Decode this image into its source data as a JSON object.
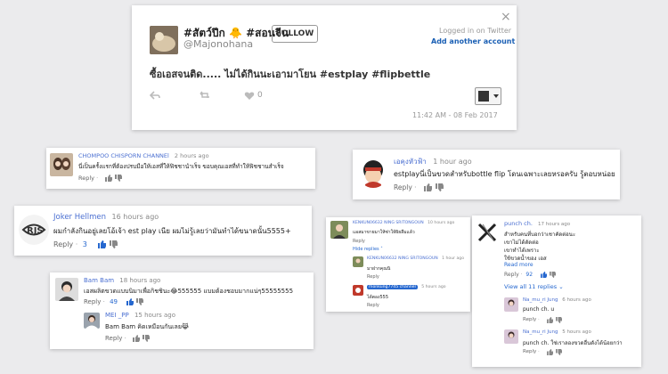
{
  "tweet": {
    "display_name": "#สัตว์ปีก 🐥 #สอนจีน",
    "handle": "@Majonohana",
    "follow_label": "FOLLOW",
    "logged_in_text": "Logged in on Twitter",
    "add_account_text": "Add another account",
    "close_glyph": "×",
    "text": "ซื้อเอสจนติด..... ไม่ได้กินนะเอามาโยน #estplay #flipbettle",
    "like_count": "0",
    "timestamp": "11:42 AM - 08 Feb 2017"
  },
  "comments": {
    "c1": {
      "author": "CHOMPOO CHISPORN CHANNEl",
      "time": "2 hours ago",
      "text": "นี่เป็นครั้งแรกที่ต้องปรบมือให้เอสที่ให้ฟิชชานำเร็จ ขอบคุณเอสที่ทำให้ฟิชชานสำเร็จ",
      "reply": "Reply",
      "dots": "·"
    },
    "c2": {
      "author": "เอคุงหัวฟ้า",
      "time": "1 hour ago",
      "text": "estplayนี่เป็นขวดสำหรับbottle flip โดนเฉพาะเลยหรอครับ รู้ตอบหน่อย",
      "reply": "Reply",
      "dots": "·"
    },
    "c3": {
      "author": "Joker Hellmen",
      "time": "16 hours ago",
      "text": "ผมกำลังกินอยู่เลยโอ้เจ้า est play เนีย ผมไม่รู้เลยว่ามันทำได้ขนาดนั้น5555+",
      "reply": "Reply",
      "dots": "·",
      "count": "3"
    },
    "c4": {
      "author": "Bam Bam",
      "time": "18 hours ago",
      "text": "เอสผลิตขวดแบบนิมาเพื่อกิชชินะ😂555555 แบมต้องชอบมากแน่ๆ55555555",
      "reply": "Reply",
      "dots": "·",
      "count": "49"
    },
    "c4r": {
      "author": "MEI _PP",
      "time": "15 hours ago",
      "text": "Bam Bam คิดเหมือนกันเลย😹",
      "reply": "Reply",
      "dots": "·"
    },
    "c5": {
      "author": "KENKUN06632 NING SRITONGOUN",
      "time": "10 hours ago",
      "text": "แอสมาขายมาให้ซ่าให้ผิยลืมแล้ว",
      "hide": "Hide replies",
      "r1_author": "KENKUN06632 NING SRITONGOUN",
      "r1_time": "1 hour ago",
      "r1_text": "มาฝากคุณนิ",
      "r2_author": "monkung7745 channel",
      "r2_time": "5 hours ago",
      "r2_text": "ได้ตอง555",
      "reply": "Reply"
    },
    "c6": {
      "author": "punch ch.",
      "time": "17 hours ago",
      "lines": [
        "สำหรับคนที่บอกว่าเชาคัดต่อนะ",
        "เขาไม่ได้ตัดต่อ",
        "เขาทำได้เพราะ",
        "ใช้ขวดน้ำของ เอส"
      ],
      "read_more": "Read more",
      "reply": "Reply",
      "dots": "·",
      "count": "92",
      "view_all": "View all 11 replies",
      "chevron": "⌄",
      "r1_author": "Na_mu_ri Jung",
      "r1_time": "6 hours ago",
      "r1_text": "punch ch. u",
      "r2_author": "Na_mu_ri Jung",
      "r2_time": "5 hours ago",
      "r2_text": "punch ch. ใช่เราลองขวดอื่นดังได้น้อยกว่า"
    }
  },
  "colors": {
    "background": "#ebebed",
    "twitter_blue": "#1a5fb4",
    "youtube_name": "#4a6fd1"
  }
}
